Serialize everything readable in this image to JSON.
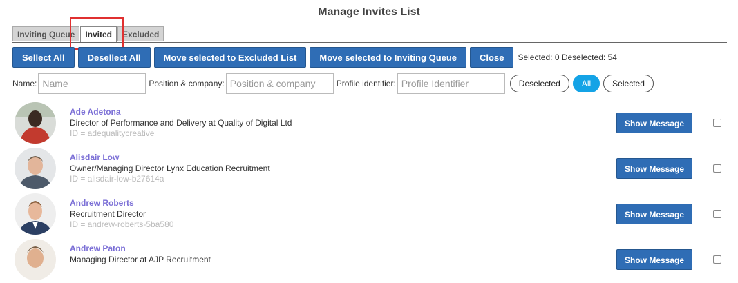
{
  "header": {
    "title": "Manage Invites List"
  },
  "tabs": [
    {
      "label": "Inviting Queue",
      "active": false
    },
    {
      "label": "Invited",
      "active": true
    },
    {
      "label": "Excluded",
      "active": false
    }
  ],
  "toolbar": {
    "select_all": "Sellect All",
    "deselect_all": "Desellect All",
    "move_excluded": "Move selected to Excluded List",
    "move_queue": "Move selected to Inviting Queue",
    "close": "Close",
    "status": "Selected: 0 Deselected: 54"
  },
  "filters": {
    "name_label": "Name:",
    "name_placeholder": "Name",
    "position_label": "Position & company:",
    "position_placeholder": "Position & company",
    "profile_label": "Profile identifier:",
    "profile_placeholder": "Profile Identifier",
    "pill_deselected": "Deselected",
    "pill_all": "All",
    "pill_selected": "Selected"
  },
  "people": [
    {
      "name": "Ade Adetona",
      "role": "Director of Performance and Delivery at Quality of Digital Ltd",
      "pid": "ID = adequalitycreative",
      "button": "Show Message"
    },
    {
      "name": "Alisdair Low",
      "role": "Owner/Managing Director Lynx Education Recruitment",
      "pid": "ID = alisdair-low-b27614a",
      "button": "Show Message"
    },
    {
      "name": "Andrew Roberts",
      "role": "Recruitment Director",
      "pid": "ID = andrew-roberts-5ba580",
      "button": "Show Message"
    },
    {
      "name": "Andrew Paton",
      "role": "Managing Director at AJP Recruitment",
      "pid": "",
      "button": "Show Message"
    }
  ],
  "colors": {
    "accent": "#2f6db5",
    "pill_active": "#14a3e6",
    "name_link": "#7b6fd6"
  }
}
